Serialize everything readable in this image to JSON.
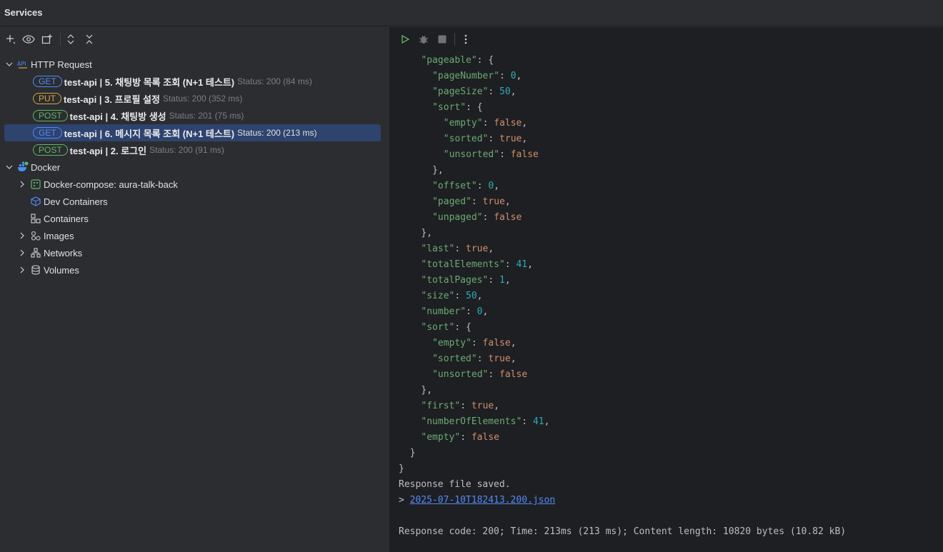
{
  "window": {
    "title": "Services"
  },
  "tree": {
    "http_group": {
      "label": "HTTP Request"
    },
    "requests": [
      {
        "method": "GET",
        "method_color": "#548af7",
        "name": "test-api  |  5. 채팅방 목록 조회 (N+1 테스트)",
        "status": "Status: 200 (84 ms)",
        "selected": false
      },
      {
        "method": "PUT",
        "method_color": "#d9a343",
        "name": "test-api  |  3. 프로필 설정",
        "status": "Status: 200 (352 ms)",
        "selected": false
      },
      {
        "method": "POST",
        "method_color": "#5fb865",
        "name": "test-api  |  4. 채팅방 생성",
        "status": "Status: 201 (75 ms)",
        "selected": false
      },
      {
        "method": "GET",
        "method_color": "#548af7",
        "name": "test-api  |  6. 메시지 목록 조회 (N+1 테스트)",
        "status": "Status: 200 (213 ms)",
        "selected": true
      },
      {
        "method": "POST",
        "method_color": "#5fb865",
        "name": "test-api  |  2. 로그인",
        "status": "Status: 200 (91 ms)",
        "selected": false
      }
    ],
    "docker_group": {
      "label": "Docker"
    },
    "docker_items": [
      {
        "label": "Docker-compose: aura-talk-back",
        "icon": "docker-compose-icon",
        "expandable": true
      },
      {
        "label": "Dev Containers",
        "icon": "dev-containers-icon",
        "expandable": false
      },
      {
        "label": "Containers",
        "icon": "containers-icon",
        "expandable": false
      },
      {
        "label": "Images",
        "icon": "images-icon",
        "expandable": true
      },
      {
        "label": "Networks",
        "icon": "networks-icon",
        "expandable": true
      },
      {
        "label": "Volumes",
        "icon": "volumes-icon",
        "expandable": true
      }
    ]
  },
  "response": {
    "lines": [
      {
        "indent": 2,
        "key": "pageable",
        "sep": ": ",
        "open": "{"
      },
      {
        "indent": 3,
        "key": "pageNumber",
        "num": "0",
        "comma": true
      },
      {
        "indent": 3,
        "key": "pageSize",
        "num": "50",
        "comma": true
      },
      {
        "indent": 3,
        "key": "sort",
        "open": "{"
      },
      {
        "indent": 4,
        "key": "empty",
        "bool": "false",
        "comma": true
      },
      {
        "indent": 4,
        "key": "sorted",
        "bool": "true",
        "comma": true
      },
      {
        "indent": 4,
        "key": "unsorted",
        "bool": "false"
      },
      {
        "indent": 3,
        "close": "},"
      },
      {
        "indent": 3,
        "key": "offset",
        "num": "0",
        "comma": true
      },
      {
        "indent": 3,
        "key": "paged",
        "bool": "true",
        "comma": true
      },
      {
        "indent": 3,
        "key": "unpaged",
        "bool": "false"
      },
      {
        "indent": 2,
        "close": "},"
      },
      {
        "indent": 2,
        "key": "last",
        "bool": "true",
        "comma": true
      },
      {
        "indent": 2,
        "key": "totalElements",
        "num": "41",
        "comma": true
      },
      {
        "indent": 2,
        "key": "totalPages",
        "num": "1",
        "comma": true
      },
      {
        "indent": 2,
        "key": "size",
        "num": "50",
        "comma": true
      },
      {
        "indent": 2,
        "key": "number",
        "num": "0",
        "comma": true
      },
      {
        "indent": 2,
        "key": "sort",
        "open": "{"
      },
      {
        "indent": 3,
        "key": "empty",
        "bool": "false",
        "comma": true
      },
      {
        "indent": 3,
        "key": "sorted",
        "bool": "true",
        "comma": true
      },
      {
        "indent": 3,
        "key": "unsorted",
        "bool": "false"
      },
      {
        "indent": 2,
        "close": "},"
      },
      {
        "indent": 2,
        "key": "first",
        "bool": "true",
        "comma": true
      },
      {
        "indent": 2,
        "key": "numberOfElements",
        "num": "41",
        "comma": true
      },
      {
        "indent": 2,
        "key": "empty",
        "bool": "false"
      },
      {
        "indent": 1,
        "close": "}"
      },
      {
        "indent": 0,
        "close": "}"
      }
    ],
    "saved_text": "Response file saved.",
    "file_prefix": "> ",
    "file_link": "2025-07-10T182413.200.json",
    "summary": "Response code: 200; Time: 213ms (213 ms); Content length: 10820 bytes (10.82 kB)"
  }
}
